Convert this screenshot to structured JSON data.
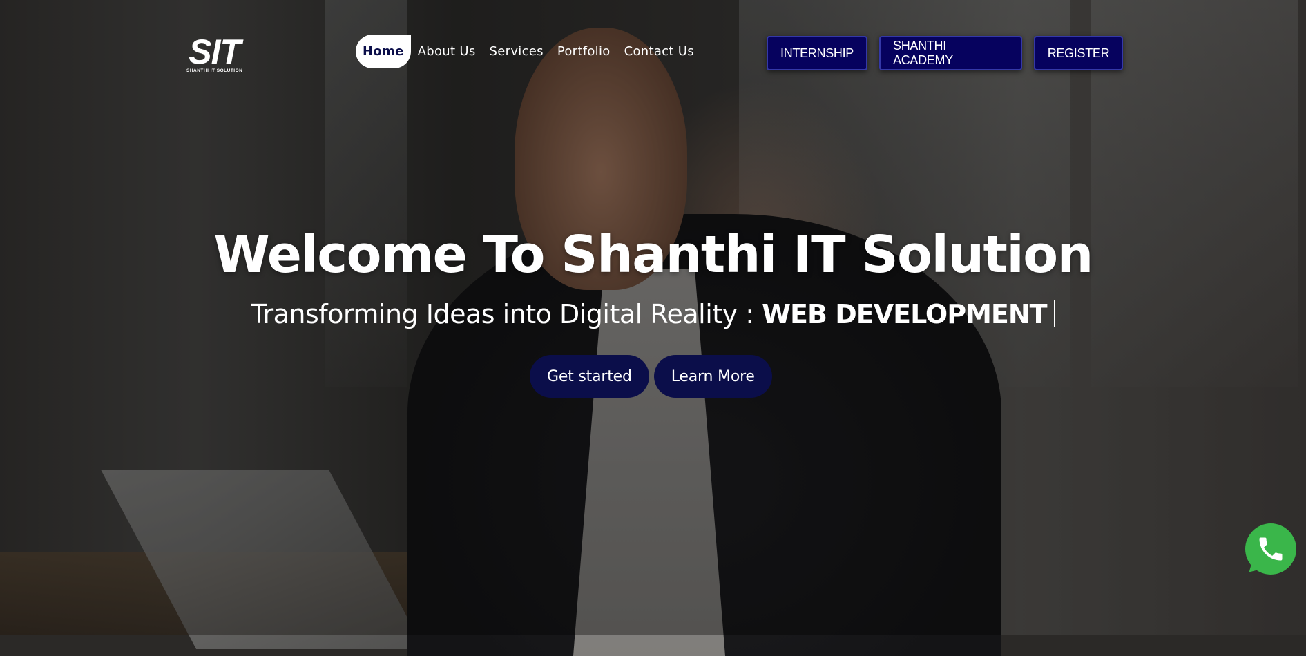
{
  "logo": {
    "mark": "SIT",
    "subtext": "SHANTHI IT SOLUTION"
  },
  "nav": {
    "items": [
      {
        "label": "Home",
        "active": true
      },
      {
        "label": "About Us",
        "active": false
      },
      {
        "label": "Services",
        "active": false
      },
      {
        "label": "Portfolio",
        "active": false
      },
      {
        "label": "Contact Us",
        "active": false
      }
    ]
  },
  "top_buttons": [
    "INTERNSHIP",
    "SHANTHI ACADEMY",
    "REGISTER"
  ],
  "hero": {
    "title": "Welcome To Shanthi IT Solution",
    "subtitle_prefix": "Transforming Ideas into Digital Reality : ",
    "typed_text": "WEB DEVELOPMENT",
    "cta_primary": "Get started",
    "cta_secondary": "Learn More"
  },
  "floating": {
    "icon": "whatsapp-icon"
  },
  "colors": {
    "brand_navy": "#0b0e4a",
    "button_navy": "#06025e",
    "whatsapp_green": "#3ab64a"
  }
}
